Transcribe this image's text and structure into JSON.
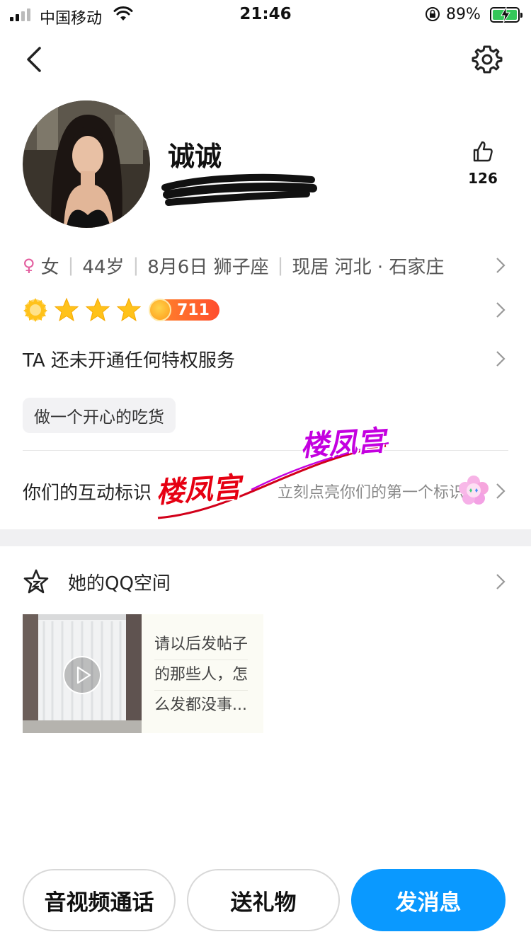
{
  "status_bar": {
    "carrier": "中国移动",
    "time": "21:46",
    "battery": "89%"
  },
  "nav": {
    "back_icon": "chevron-left-icon",
    "settings_icon": "gear-icon"
  },
  "profile": {
    "nickname": "诚诚",
    "like_count": "126",
    "gender": "女",
    "age": "44岁",
    "birthday": "8月6日 狮子座",
    "location": "现居 河北 · 石家庄",
    "star_level_value": "711",
    "privilege": "TA 还未开通任何特权服务",
    "tag": "做一个开心的吃货"
  },
  "interaction": {
    "label": "你们的互动标识",
    "hint": "立刻点亮你们的第一个标识"
  },
  "watermark": {
    "text": "楼凤宫"
  },
  "qzone": {
    "title": "她的QQ空间",
    "post_line1": "请以后发帖子",
    "post_line2": "的那些人，怎",
    "post_line3": "么发都没事..."
  },
  "actions": {
    "call": "音视频通话",
    "gift": "送礼物",
    "message": "发消息"
  },
  "colors": {
    "primary": "#0a99ff",
    "female": "#e35d9e",
    "star": "#ffc21a",
    "level_badge": "#ff5a2e"
  }
}
